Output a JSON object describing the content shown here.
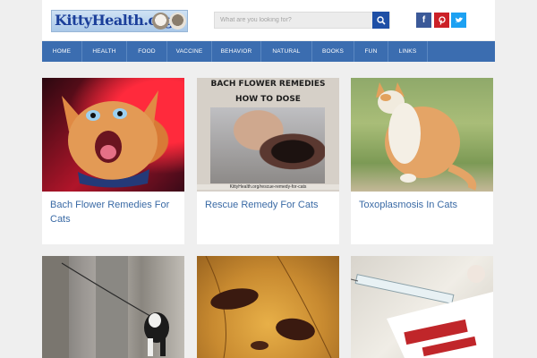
{
  "site": {
    "logo_text": "KittyHealth.org"
  },
  "search": {
    "placeholder": "What are you looking for?"
  },
  "social": [
    {
      "name": "facebook",
      "glyph": "f",
      "color": "#3b5998"
    },
    {
      "name": "pinterest",
      "glyph": "p",
      "color": "#cb2027"
    },
    {
      "name": "twitter",
      "glyph": "t",
      "color": "#1da1f2"
    }
  ],
  "nav": {
    "items": [
      {
        "label": "HOME"
      },
      {
        "label": "HEALTH"
      },
      {
        "label": "FOOD"
      },
      {
        "label": "VACCINE"
      },
      {
        "label": "BEHAVIOR"
      },
      {
        "label": "NATURAL"
      },
      {
        "label": "BOOKS"
      },
      {
        "label": "FUN"
      },
      {
        "label": "LINKS"
      }
    ]
  },
  "articles": [
    {
      "title": "Bach Flower Remedies For Cats",
      "image": "screaming-kitten"
    },
    {
      "title": "Rescue Remedy For Cats",
      "image": "rescue-remedy-dosing",
      "image_heading_1": "BACH FLOWER REMEDIES",
      "image_heading_2": "HOW TO DOSE",
      "image_caption": "KittyHealth.org/rescue-remedy-for-cats"
    },
    {
      "title": "Toxoplasmosis In Cats",
      "image": "orange-white-cat-grass"
    },
    {
      "title": "",
      "image": "cat-on-leash"
    },
    {
      "title": "",
      "image": "fleas-closeup"
    },
    {
      "title": "",
      "image": "syringe-medicine"
    }
  ],
  "colors": {
    "nav_bg": "#3b6db0",
    "link": "#3a6aa5",
    "search_button": "#1e4fa6",
    "page_bg": "#efefef"
  }
}
